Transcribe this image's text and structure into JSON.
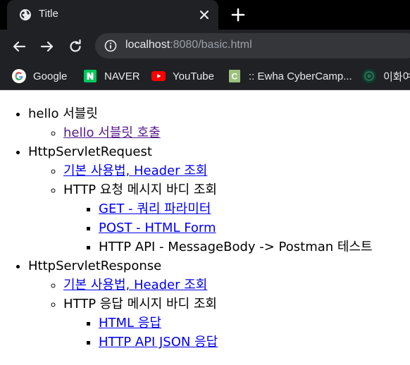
{
  "browser": {
    "tab_title": "Title",
    "url_host": "localhost",
    "url_rest": ":8080/basic.html",
    "bookmarks": [
      {
        "label": "Google",
        "icon": "google-icon"
      },
      {
        "label": "NAVER",
        "icon": "naver-icon"
      },
      {
        "label": "YouTube",
        "icon": "youtube-icon"
      },
      {
        "label": ":: Ewha CyberCamp...",
        "icon": "cybercamp-icon"
      },
      {
        "label": "이화여",
        "icon": "ewha-icon"
      }
    ]
  },
  "page": {
    "sections": [
      {
        "label": "hello 서블릿",
        "items": [
          {
            "label": "hello 서블릿 호출",
            "link": true,
            "visited": true
          }
        ]
      },
      {
        "label": "HttpServletRequest",
        "items": [
          {
            "label": "기본 사용법, Header 조회",
            "link": true
          },
          {
            "label": "HTTP 요청 메시지 바디 조회",
            "link": false,
            "items": [
              {
                "label": "GET - 쿼리 파라미터",
                "link": true
              },
              {
                "label": "POST - HTML Form",
                "link": true
              },
              {
                "label": "HTTP API - MessageBody -> Postman 테스트",
                "link": false
              }
            ]
          }
        ]
      },
      {
        "label": "HttpServletResponse",
        "items": [
          {
            "label": "기본 사용법, Header 조회",
            "link": true
          },
          {
            "label": "HTTP 응답 메시지 바디 조회",
            "link": false,
            "items": [
              {
                "label": "HTML 응답",
                "link": true
              },
              {
                "label": "HTTP API JSON 응답",
                "link": true
              }
            ]
          }
        ]
      }
    ]
  }
}
